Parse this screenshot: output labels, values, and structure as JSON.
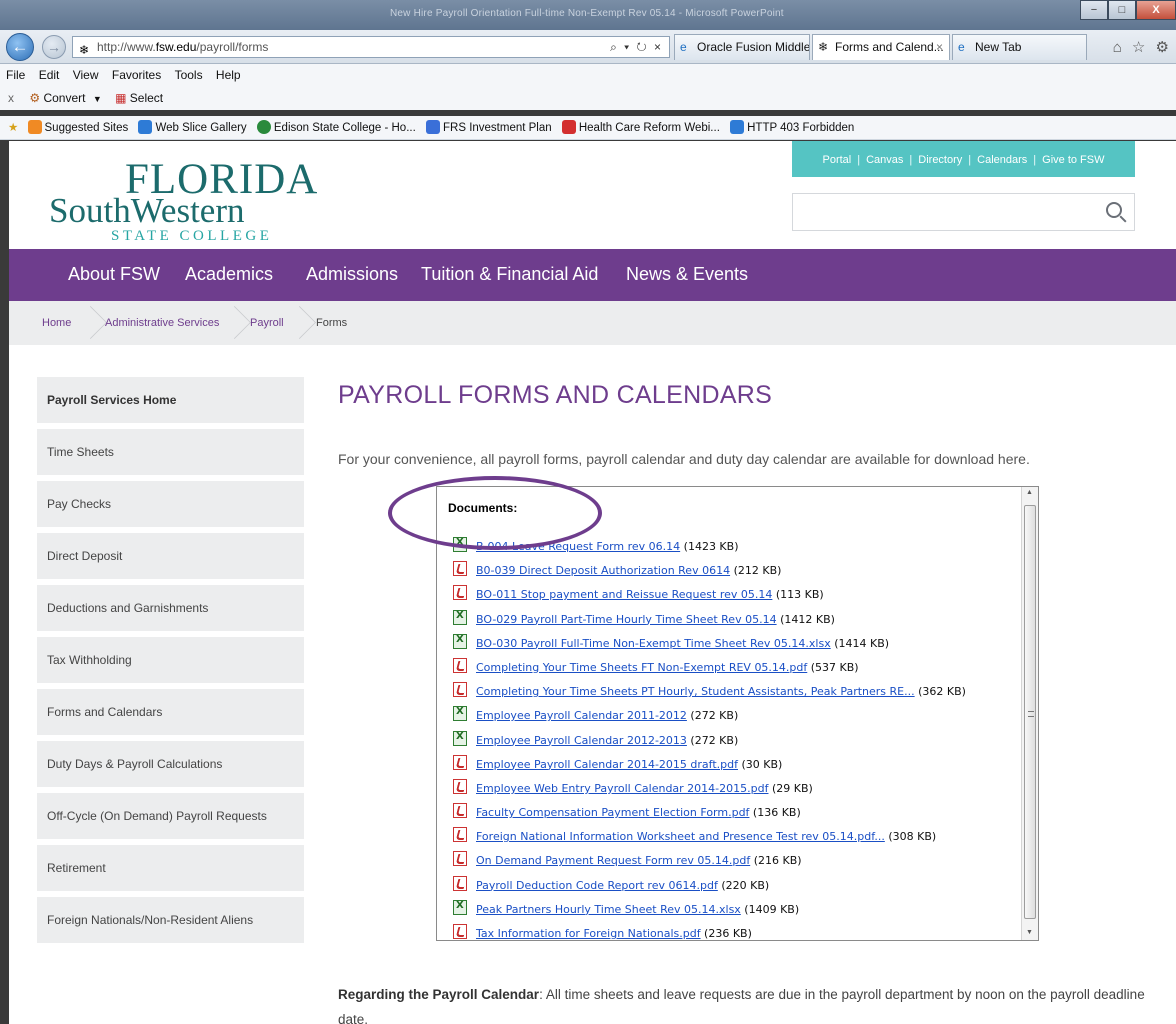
{
  "window": {
    "title": "New Hire Payroll Orientation Full-time Non-Exempt Rev 05.14 - Microsoft PowerPoint",
    "controls": [
      "−",
      "□",
      "X"
    ]
  },
  "browser": {
    "url_prefix": "http://www.",
    "url_domain": "fsw.edu",
    "url_path": "/payroll/forms",
    "addr_controls": "⌕ ▾ ↻ ×",
    "tabs": [
      {
        "label": "Oracle Fusion Middle...",
        "close": ""
      },
      {
        "label": "Forms and Calend...",
        "close": "×"
      },
      {
        "label": "New Tab",
        "close": ""
      }
    ],
    "toolbar_icons": "⌂ ☆ ⚙"
  },
  "menu": [
    "File",
    "Edit",
    "View",
    "Favorites",
    "Tools",
    "Help"
  ],
  "command_bar": {
    "close": "x",
    "convert": "Convert",
    "select": "Select"
  },
  "favorites": [
    {
      "label": "Suggested Sites",
      "color": "#f08a24"
    },
    {
      "label": "Web Slice Gallery",
      "color": "#2e7bd6"
    },
    {
      "label": "Edison State College - Ho...",
      "color": "#2a8a3c"
    },
    {
      "label": "FRS Investment Plan",
      "color": "#3a6fd8"
    },
    {
      "label": "Health Care Reform Webi...",
      "color": "#d32f2f"
    },
    {
      "label": "HTTP 403 Forbidden",
      "color": "#2e7bd6"
    }
  ],
  "site": {
    "logo": {
      "line1": "FLORIDA",
      "line2": "SouthWestern",
      "line3": "STATE COLLEGE"
    },
    "utility_links": [
      "Portal",
      "Canvas",
      "Directory",
      "Calendars",
      "Give to FSW"
    ],
    "nav": [
      "About FSW",
      "Academics",
      "Admissions",
      "Tuition & Financial Aid",
      "News & Events"
    ],
    "breadcrumbs": [
      "Home",
      "Administrative Services",
      "Payroll",
      "Forms"
    ],
    "sidebar": [
      "Payroll Services Home",
      "Time Sheets",
      "Pay Checks",
      "Direct Deposit",
      "Deductions and Garnishments",
      "Tax Withholding",
      "Forms and Calendars",
      "Duty Days & Payroll Calculations",
      "Off-Cycle (On Demand) Payroll Requests",
      "Retirement",
      "Foreign Nationals/Non-Resident Aliens"
    ],
    "page_title": "PAYROLL FORMS AND CALENDARS",
    "intro": "For your convenience, all payroll forms, payroll calendar and duty day calendar are available for download here.",
    "documents_header": "Documents:",
    "documents": [
      {
        "icon": "xls",
        "name": "B-004 Leave Request Form rev 06.14",
        "size": " (1423 KB)"
      },
      {
        "icon": "pdf",
        "name": "B0-039 Direct Deposit Authorization Rev 0614",
        "size": " (212 KB)"
      },
      {
        "icon": "pdf",
        "name": "BO-011 Stop payment and Reissue Request rev 05.14",
        "size": " (113 KB)"
      },
      {
        "icon": "xls",
        "name": "BO-029 Payroll Part-Time Hourly Time Sheet Rev 05.14",
        "size": " (1412 KB)"
      },
      {
        "icon": "xls",
        "name": "BO-030 Payroll Full-Time Non-Exempt Time Sheet Rev 05.14.xlsx",
        "size": " (1414 KB)"
      },
      {
        "icon": "pdf",
        "name": "Completing Your Time Sheets FT Non-Exempt REV 05.14.pdf",
        "size": " (537 KB)"
      },
      {
        "icon": "pdf",
        "name": "Completing Your Time Sheets PT Hourly, Student Assistants, Peak Partners RE...",
        "size": " (362 KB)"
      },
      {
        "icon": "xls",
        "name": "Employee Payroll Calendar 2011-2012",
        "size": " (272 KB)"
      },
      {
        "icon": "xls",
        "name": "Employee Payroll Calendar 2012-2013",
        "size": " (272 KB)"
      },
      {
        "icon": "pdf",
        "name": "Employee Payroll Calendar 2014-2015 draft.pdf",
        "size": " (30 KB)"
      },
      {
        "icon": "pdf",
        "name": "Employee Web Entry Payroll Calendar 2014-2015.pdf",
        "size": " (29 KB)"
      },
      {
        "icon": "pdf",
        "name": "Faculty Compensation Payment Election Form.pdf",
        "size": " (136 KB)"
      },
      {
        "icon": "pdf",
        "name": "Foreign National Information Worksheet and Presence Test rev 05.14.pdf...",
        "size": " (308 KB)"
      },
      {
        "icon": "pdf",
        "name": "On Demand Payment Request Form rev 05.14.pdf",
        "size": " (216 KB)"
      },
      {
        "icon": "pdf",
        "name": "Payroll Deduction Code Report rev 0614.pdf",
        "size": " (220 KB)"
      },
      {
        "icon": "xls",
        "name": "Peak Partners Hourly Time Sheet Rev 05.14.xlsx",
        "size": " (1409 KB)"
      },
      {
        "icon": "pdf",
        "name": "Tax Information for Foreign Nationals.pdf",
        "size": " (236 KB)"
      }
    ],
    "regarding_label": "Regarding the Payroll Calendar",
    "regarding_text": ": All time sheets and leave requests are due in the payroll department by noon on the payroll deadline date."
  },
  "colors": {
    "brand_purple": "#6e3d8d",
    "brand_teal": "#1c6b6c",
    "utility_teal": "#55c4c3",
    "link_blue": "#1a4fc5"
  }
}
